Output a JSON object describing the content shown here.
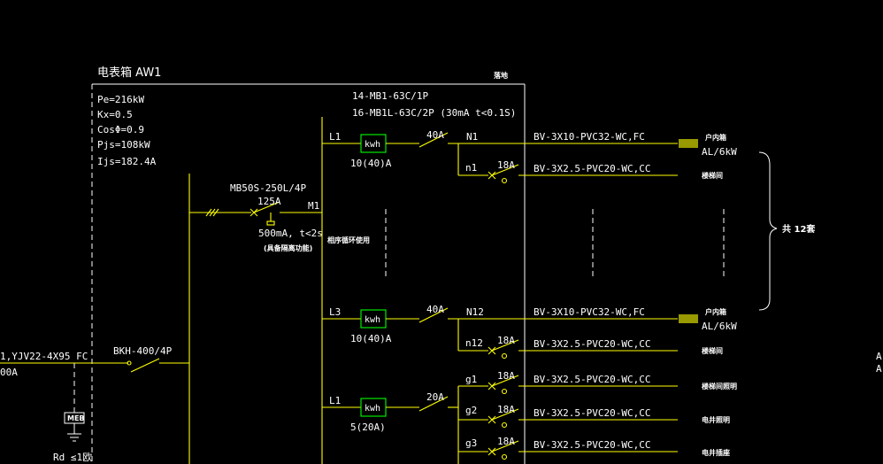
{
  "box": {
    "title": "电表箱 AW1",
    "note_top": "落地",
    "params": [
      "Pe=216kW",
      "Kx=0.5",
      "CosΦ=0.9",
      "Pjs=108kW",
      "Ijs=182.4A"
    ]
  },
  "incoming": {
    "cable": "1,YJV22-4X95 FC",
    "current": "00A",
    "breaker": "BKH-400/4P",
    "ground": "Rd ≤1欧",
    "meb": "MEB"
  },
  "main_breaker": {
    "model": "MB50S-250L/4P",
    "rating": "125A",
    "leak1": "500mA, t<2s",
    "leak2": "(具备隔离功能)",
    "bus": "M1"
  },
  "meter_models": {
    "line1": "14-MB1-63C/1P",
    "line2": "16-MB1L-63C/2P (30mA t<0.1S)"
  },
  "phase_note": "相序循环使用",
  "meter_label": "kwh",
  "branches": [
    {
      "phase": "L1",
      "meter": "10(40)A",
      "breaker": "40A",
      "code": "N1",
      "cable": "BV-3X10-PVC32-WC,FC",
      "dest": "户内箱",
      "load": "AL/6kW"
    },
    {
      "sub": "n1",
      "breaker": "18A",
      "cable": "BV-3X2.5-PVC20-WC,CC",
      "dest": "楼梯间"
    },
    {
      "phase": "L3",
      "meter": "10(40)A",
      "breaker": "40A",
      "code": "N12",
      "cable": "BV-3X10-PVC32-WC,FC",
      "dest": "户内箱",
      "load": "AL/6kW"
    },
    {
      "sub": "n12",
      "breaker": "18A",
      "cable": "BV-3X2.5-PVC20-WC,CC",
      "dest": "楼梯间"
    },
    {
      "phase": "L1",
      "meter": "5(20A)",
      "breaker": "20A"
    },
    {
      "sub": "g1",
      "breaker": "18A",
      "cable": "BV-3X2.5-PVC20-WC,CC",
      "dest": "楼梯间照明"
    },
    {
      "sub": "g2",
      "breaker": "18A",
      "cable": "BV-3X2.5-PVC20-WC,CC",
      "dest": "电井照明"
    },
    {
      "sub": "g3",
      "breaker": "18A",
      "cable": "BV-3X2.5-PVC20-WC,CC",
      "dest": "电井插座"
    }
  ],
  "brace_label": "共 12套",
  "edge_right": [
    "A",
    "A"
  ]
}
